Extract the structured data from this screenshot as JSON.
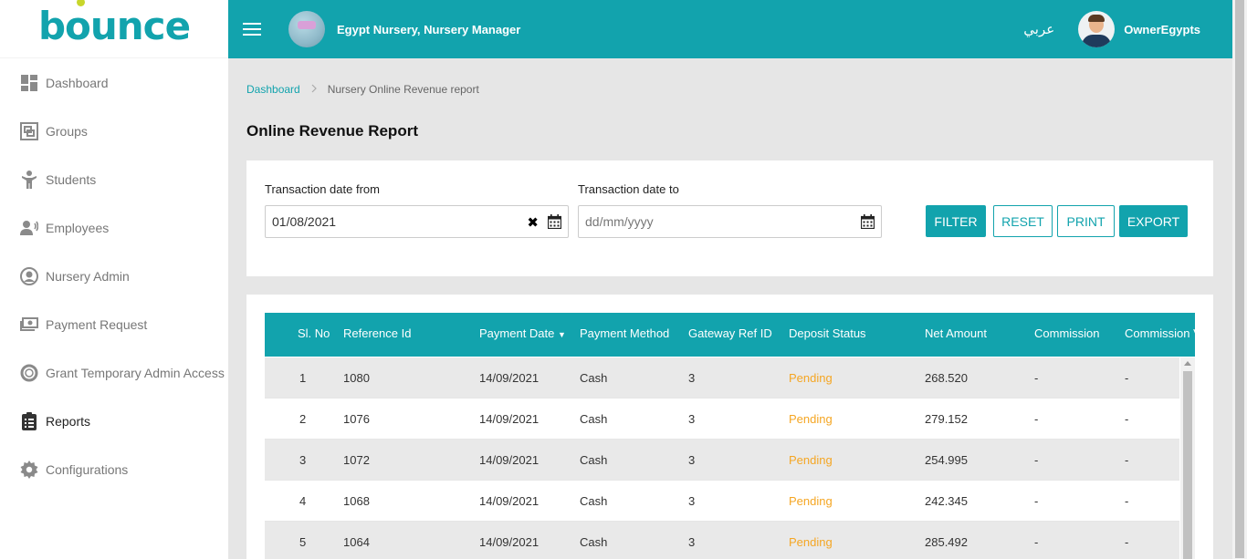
{
  "brand": {
    "logo_text": "bounce"
  },
  "topbar": {
    "nursery_title": "Egypt Nursery, Nursery Manager",
    "language": "عربي",
    "user_name": "OwnerEgypts"
  },
  "sidebar": {
    "items": [
      {
        "label": "Dashboard",
        "icon": "dashboard-icon"
      },
      {
        "label": "Groups",
        "icon": "groups-icon"
      },
      {
        "label": "Students",
        "icon": "student-icon"
      },
      {
        "label": "Employees",
        "icon": "employees-icon"
      },
      {
        "label": "Nursery Admin",
        "icon": "user-circle-icon"
      },
      {
        "label": "Payment Request",
        "icon": "money-icon"
      },
      {
        "label": "Grant Temporary Admin Access",
        "icon": "lifebuoy-icon"
      },
      {
        "label": "Reports",
        "icon": "clipboard-icon"
      },
      {
        "label": "Configurations",
        "icon": "gear-icon"
      }
    ]
  },
  "breadcrumb": {
    "home": "Dashboard",
    "current": "Nursery Online Revenue report"
  },
  "page": {
    "title": "Online Revenue Report"
  },
  "filter": {
    "from_label": "Transaction date from",
    "from_value": "01/08/2021",
    "to_label": "Transaction date to",
    "to_placeholder": "dd/mm/yyyy",
    "buttons": {
      "filter": "FILTER",
      "reset": "RESET",
      "print": "PRINT",
      "export": "EXPORT"
    }
  },
  "table": {
    "headers": [
      "Sl. No",
      "Reference Id",
      "Payment Date",
      "Payment Method",
      "Gateway Ref ID",
      "Deposit Status",
      "Net Amount",
      "Commission",
      "Commission V"
    ],
    "sort_indicator": "▼",
    "rows": [
      [
        "1",
        "1080",
        "14/09/2021",
        "Cash",
        "3",
        "Pending",
        "268.520",
        "-",
        "-"
      ],
      [
        "2",
        "1076",
        "14/09/2021",
        "Cash",
        "3",
        "Pending",
        "279.152",
        "-",
        "-"
      ],
      [
        "3",
        "1072",
        "14/09/2021",
        "Cash",
        "3",
        "Pending",
        "254.995",
        "-",
        "-"
      ],
      [
        "4",
        "1068",
        "14/09/2021",
        "Cash",
        "3",
        "Pending",
        "242.345",
        "-",
        "-"
      ],
      [
        "5",
        "1064",
        "14/09/2021",
        "Cash",
        "3",
        "Pending",
        "285.492",
        "-",
        "-"
      ]
    ]
  },
  "colors": {
    "brand": "#12a3ad",
    "pending": "#f5a623",
    "logo_accent": "#c8d62b"
  }
}
